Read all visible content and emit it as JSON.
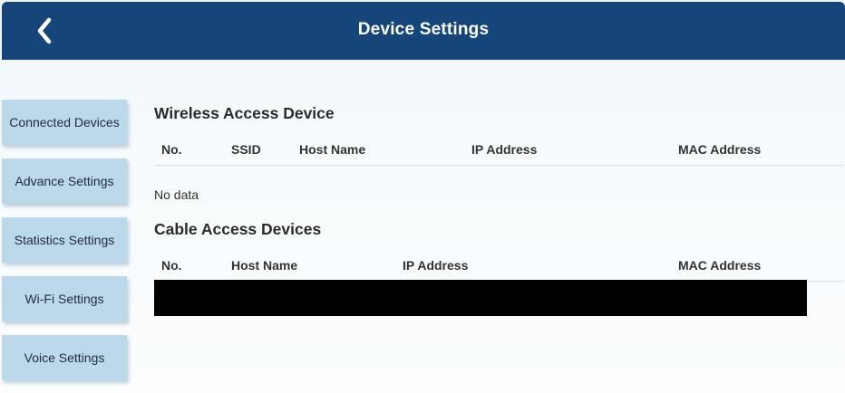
{
  "header": {
    "title": "Device Settings",
    "back_icon": "chevron-left-icon"
  },
  "sidebar": {
    "items": [
      {
        "label": "Connected Devices"
      },
      {
        "label": "Advance Settings"
      },
      {
        "label": "Statistics Settings"
      },
      {
        "label": "Wi-Fi Settings"
      },
      {
        "label": "Voice Settings"
      }
    ]
  },
  "wireless": {
    "title": "Wireless Access Device",
    "columns": [
      "No.",
      "SSID",
      "Host Name",
      "IP Address",
      "MAC Address"
    ],
    "empty_text": "No data"
  },
  "cable": {
    "title": "Cable Access Devices",
    "columns": [
      "No.",
      "Host Name",
      "IP Address",
      "MAC Address"
    ]
  },
  "colors": {
    "header_bg": "#16457a",
    "sidebar_button_bg": "#bcd8eb",
    "page_bg": "#f4f9fc"
  }
}
